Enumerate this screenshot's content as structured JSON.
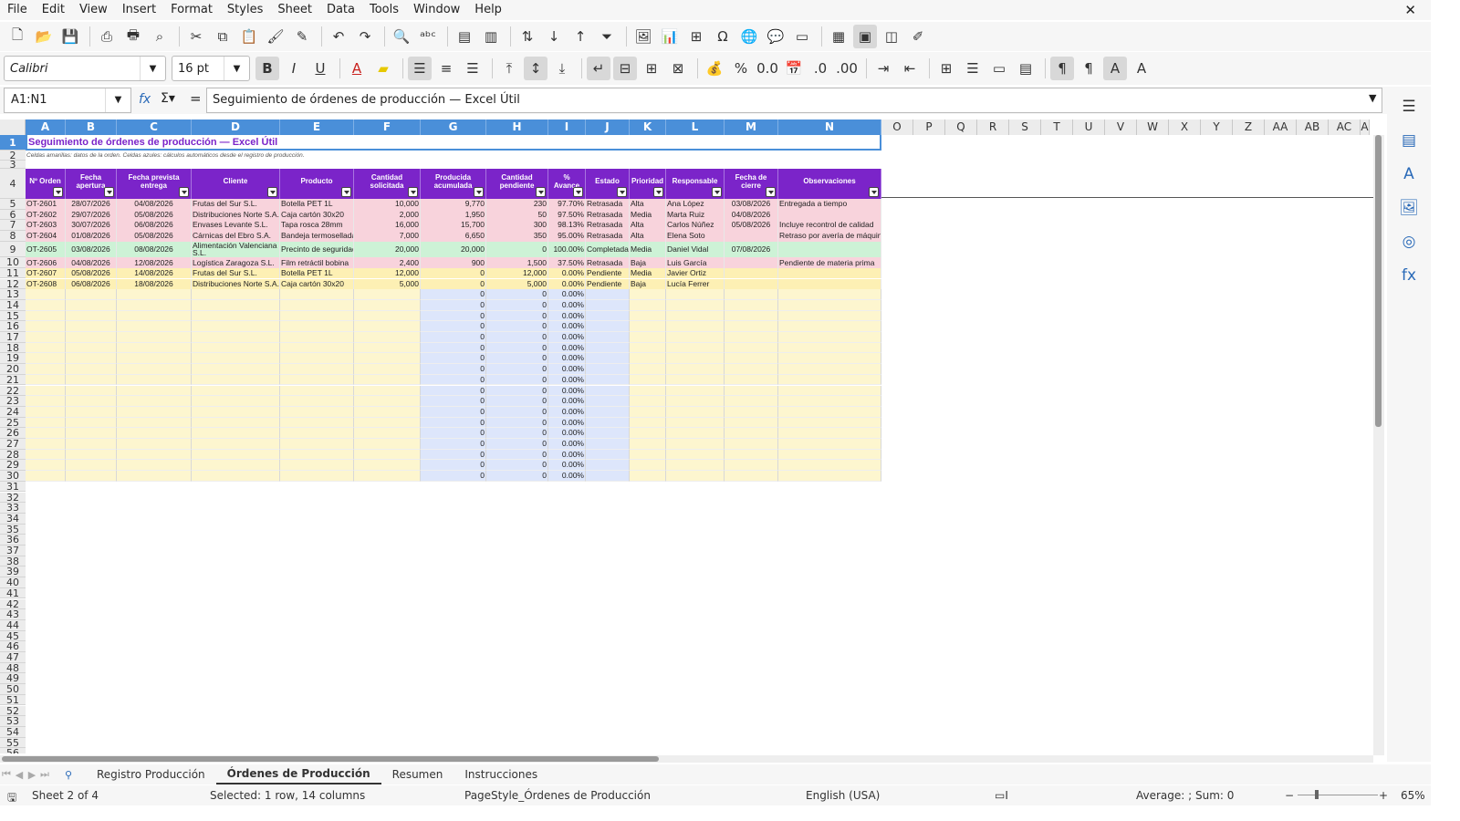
{
  "menu": [
    "File",
    "Edit",
    "View",
    "Insert",
    "Format",
    "Styles",
    "Sheet",
    "Data",
    "Tools",
    "Window",
    "Help"
  ],
  "font": {
    "name": "Calibri",
    "size": "16 pt"
  },
  "namebox": "A1:N1",
  "formula": "Seguimiento de órdenes de producción — Excel Útil",
  "columns": [
    "A",
    "B",
    "C",
    "D",
    "E",
    "F",
    "G",
    "H",
    "I",
    "J",
    "K",
    "L",
    "M",
    "N",
    "O",
    "P",
    "Q",
    "R",
    "S",
    "T",
    "U",
    "V",
    "W",
    "X",
    "Y",
    "Z",
    "AA",
    "AB",
    "AC",
    "A"
  ],
  "title": "Seguimiento de órdenes de producción — Excel Útil",
  "subtitle": "Celdas amarillas: datos de la orden. Celdas azules: cálculos automáticos desde el registro de producción.",
  "headers": [
    "Nº Orden",
    "Fecha apertura",
    "Fecha prevista entrega",
    "Cliente",
    "Producto",
    "Cantidad solicitada",
    "Producida acumulada",
    "Cantidad pendiente",
    "% Avance",
    "Estado",
    "Prioridad",
    "Responsable",
    "Fecha de cierre",
    "Observaciones"
  ],
  "orders": [
    [
      "OT-2601",
      "28/07/2026",
      "04/08/2026",
      "Frutas del Sur S.L.",
      "Botella PET 1L",
      "10,000",
      "9,770",
      "230",
      "97.70%",
      "Retrasada",
      "Alta",
      "Ana López",
      "03/08/2026",
      "Entregada a tiempo"
    ],
    [
      "OT-2602",
      "29/07/2026",
      "05/08/2026",
      "Distribuciones Norte S.A.",
      "Caja cartón 30x20",
      "2,000",
      "1,950",
      "50",
      "97.50%",
      "Retrasada",
      "Media",
      "Marta Ruiz",
      "04/08/2026",
      ""
    ],
    [
      "OT-2603",
      "30/07/2026",
      "06/08/2026",
      "Envases Levante S.L.",
      "Tapa rosca 28mm",
      "16,000",
      "15,700",
      "300",
      "98.13%",
      "Retrasada",
      "Alta",
      "Carlos Núñez",
      "05/08/2026",
      "Incluye recontrol de calidad"
    ],
    [
      "OT-2604",
      "01/08/2026",
      "05/08/2026",
      "Cárnicas del Ebro S.A.",
      "Bandeja termosellada",
      "7,000",
      "6,650",
      "350",
      "95.00%",
      "Retrasada",
      "Alta",
      "Elena Soto",
      "",
      "Retraso por avería de máquina"
    ],
    [
      "OT-2605",
      "03/08/2026",
      "08/08/2026",
      "Alimentación Valenciana S.L.",
      "Precinto de seguridad",
      "20,000",
      "20,000",
      "0",
      "100.00%",
      "Completada",
      "Media",
      "Daniel Vidal",
      "07/08/2026",
      ""
    ],
    [
      "OT-2606",
      "04/08/2026",
      "12/08/2026",
      "Logística Zaragoza S.L.",
      "Film retráctil bobina",
      "2,400",
      "900",
      "1,500",
      "37.50%",
      "Retrasada",
      "Baja",
      "Luis García",
      "",
      "Pendiente de materia prima"
    ],
    [
      "OT-2607",
      "05/08/2026",
      "14/08/2026",
      "Frutas del Sur S.L.",
      "Botella PET 1L",
      "12,000",
      "0",
      "12,000",
      "0.00%",
      "Pendiente",
      "Media",
      "Javier Ortiz",
      "",
      ""
    ],
    [
      "OT-2608",
      "06/08/2026",
      "18/08/2026",
      "Distribuciones Norte S.A.",
      "Caja cartón 30x20",
      "5,000",
      "0",
      "5,000",
      "0.00%",
      "Pendiente",
      "Baja",
      "Lucía Ferrer",
      "",
      ""
    ]
  ],
  "empty_calc": {
    "g": "0",
    "h": "0",
    "i": "0.00%"
  },
  "row_colors": {
    "retrasada": "#f8d3dc",
    "completada": "#cdf2d6",
    "pendiente": "#fdf0b4",
    "input": "#fdf6cf",
    "calc": "#dde6fb",
    "header": "#7b24c9",
    "title": "#7b24c9"
  },
  "tabs": [
    "Registro Producción",
    "Órdenes de Producción",
    "Resumen",
    "Instrucciones"
  ],
  "status": {
    "sheet": "Sheet 2 of 4",
    "selected": "Selected: 1 row, 14 columns",
    "pagestyle": "PageStyle_Órdenes de Producción",
    "lang": "English (USA)",
    "sum": "Average: ; Sum: 0",
    "zoom": "65%"
  }
}
